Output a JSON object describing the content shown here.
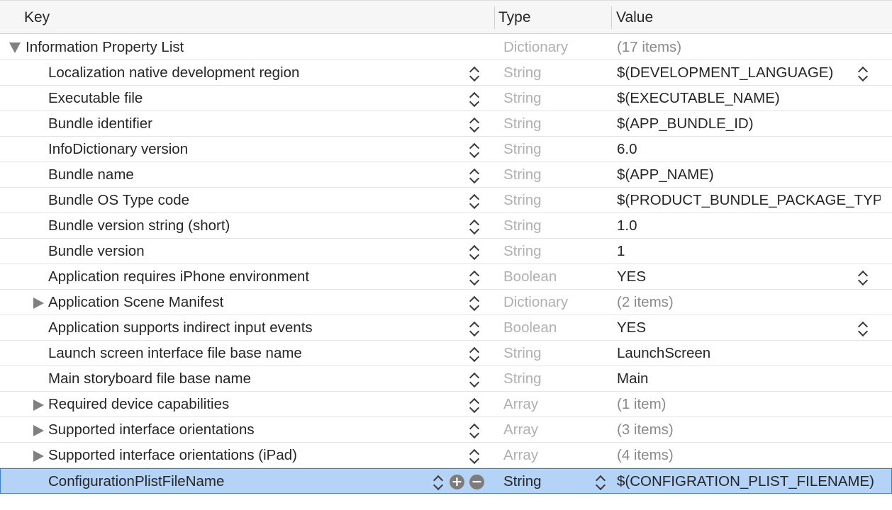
{
  "header": {
    "key": "Key",
    "type": "Type",
    "value": "Value"
  },
  "root": {
    "key": "Information Property List",
    "type": "Dictionary",
    "value": "(17 items)"
  },
  "rows": [
    {
      "key": "Localization native development region",
      "type": "String",
      "value": "$(DEVELOPMENT_LANGUAGE)"
    },
    {
      "key": "Executable file",
      "type": "String",
      "value": "$(EXECUTABLE_NAME)"
    },
    {
      "key": "Bundle identifier",
      "type": "String",
      "value": "$(APP_BUNDLE_ID)"
    },
    {
      "key": "InfoDictionary version",
      "type": "String",
      "value": "6.0"
    },
    {
      "key": "Bundle name",
      "type": "String",
      "value": "$(APP_NAME)"
    },
    {
      "key": "Bundle OS Type code",
      "type": "String",
      "value": "$(PRODUCT_BUNDLE_PACKAGE_TYPE)"
    },
    {
      "key": "Bundle version string (short)",
      "type": "String",
      "value": "1.0"
    },
    {
      "key": "Bundle version",
      "type": "String",
      "value": "1"
    },
    {
      "key": "Application requires iPhone environment",
      "type": "Boolean",
      "value": "YES"
    },
    {
      "key": "Application Scene Manifest",
      "type": "Dictionary",
      "value": "(2 items)"
    },
    {
      "key": "Application supports indirect input events",
      "type": "Boolean",
      "value": "YES"
    },
    {
      "key": "Launch screen interface file base name",
      "type": "String",
      "value": "LaunchScreen"
    },
    {
      "key": "Main storyboard file base name",
      "type": "String",
      "value": "Main"
    },
    {
      "key": "Required device capabilities",
      "type": "Array",
      "value": "(1 item)"
    },
    {
      "key": "Supported interface orientations",
      "type": "Array",
      "value": "(3 items)"
    },
    {
      "key": "Supported interface orientations (iPad)",
      "type": "Array",
      "value": "(4 items)"
    },
    {
      "key": "ConfigurationPlistFileName",
      "type": "String",
      "value": "$(CONFIGRATION_PLIST_FILENAME)"
    }
  ],
  "buttons": {
    "add": "+",
    "remove": "−"
  }
}
